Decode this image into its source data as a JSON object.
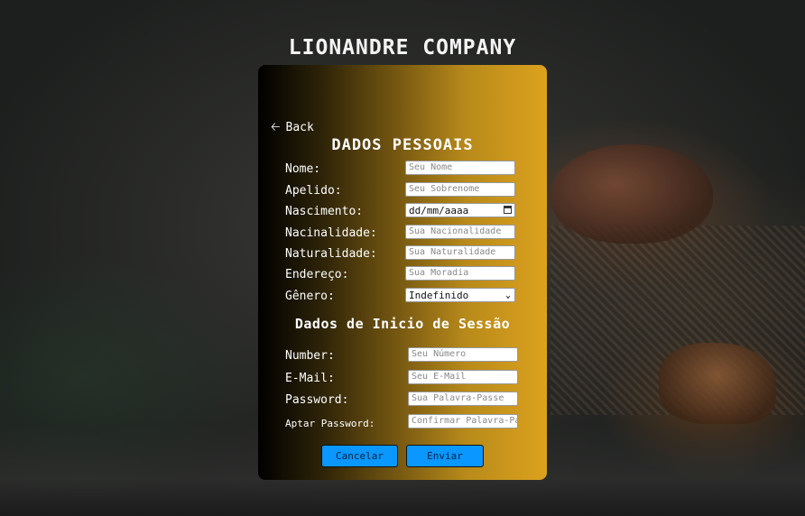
{
  "brand": "LIONANDRE COMPANY",
  "back_label": "Back",
  "sections": {
    "personal_title": "DADOS PESSOAIS",
    "session_title": "Dados de Inicio de Sessão"
  },
  "personal_fields": [
    {
      "label": "Nome:",
      "placeholder": "Seu Nome"
    },
    {
      "label": "Apelido:",
      "placeholder": "Seu Sobrenome"
    },
    {
      "label": "Nascimento:",
      "value": "dd/mm/aaaa"
    },
    {
      "label": "Nacinalidade:",
      "placeholder": "Sua Nacionalidade"
    },
    {
      "label": "Naturalidade:",
      "placeholder": "Sua Naturalidade"
    },
    {
      "label": "Endereço:",
      "placeholder": "Sua Moradia"
    },
    {
      "label": "Gênero:",
      "selected": "Indefinido"
    }
  ],
  "session_fields": [
    {
      "label": "Number:",
      "placeholder": "Seu Número"
    },
    {
      "label": "E-Mail:",
      "placeholder": "Seu E-Mail"
    },
    {
      "label": "Password:",
      "placeholder": "Sua Palavra-Passe"
    },
    {
      "label": "Aptar Password:",
      "placeholder": "Confirmar Palavra-Passe"
    }
  ],
  "buttons": {
    "cancel": "Cancelar",
    "submit": "Enviar"
  },
  "colors": {
    "button_bg": "#0a97ff",
    "card_gradient_start": "#000000",
    "card_gradient_end": "#dca21e"
  },
  "icons": {
    "back": "arrow-left-icon",
    "date": "calendar-icon",
    "select": "chevron-down-icon"
  }
}
